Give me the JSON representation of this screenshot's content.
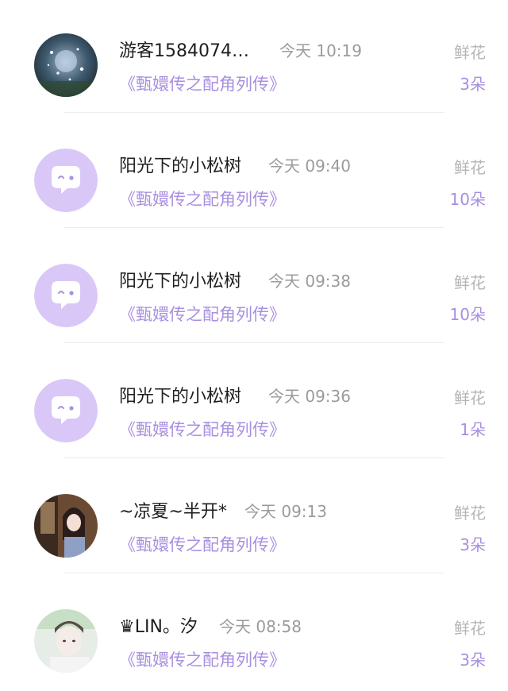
{
  "rows": [
    {
      "name": "游客1584074…",
      "time": "今天 10:19",
      "book": "《甄嬛传之配角列传》",
      "flower_label": "鲜花",
      "flower_count": "3朵",
      "avatar": "photo-sparkle"
    },
    {
      "name": "阳光下的小松树",
      "time": "今天 09:40",
      "book": "《甄嬛传之配角列传》",
      "flower_label": "鲜花",
      "flower_count": "10朵",
      "avatar": "default-chat-bubble"
    },
    {
      "name": "阳光下的小松树",
      "time": "今天 09:38",
      "book": "《甄嬛传之配角列传》",
      "flower_label": "鲜花",
      "flower_count": "10朵",
      "avatar": "default-chat-bubble"
    },
    {
      "name": "阳光下的小松树",
      "time": "今天 09:36",
      "book": "《甄嬛传之配角列传》",
      "flower_label": "鲜花",
      "flower_count": "1朵",
      "avatar": "default-chat-bubble"
    },
    {
      "name": "~凉夏~半开*",
      "time": "今天 09:13",
      "book": "《甄嬛传之配角列传》",
      "flower_label": "鲜花",
      "flower_count": "3朵",
      "avatar": "photo-girl"
    },
    {
      "name": "♛LIN。汐",
      "time": "今天 08:58",
      "book": "《甄嬛传之配角列传》",
      "flower_label": "鲜花",
      "flower_count": "3朵",
      "avatar": "photo-soft"
    }
  ],
  "colors": {
    "accent": "#a98fe0",
    "avatar_bg": "#d9c8f7",
    "muted": "#9b9b9b"
  }
}
